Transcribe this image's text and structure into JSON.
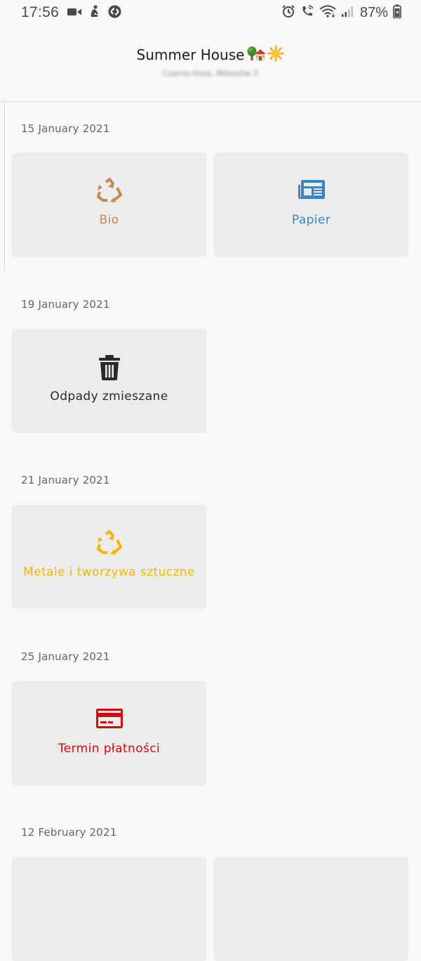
{
  "status_bar": {
    "time": "17:56",
    "battery": "87%",
    "icons": [
      "video-camera-icon",
      "person-sitting-icon",
      "shazam-icon",
      "alarm-icon",
      "wifi-calling-icon",
      "wifi-icon",
      "signal-icon",
      "battery-charging-icon"
    ]
  },
  "header": {
    "title": "Summer House",
    "emoji_icons": [
      "tree-house-emoji",
      "sun-emoji"
    ],
    "subtitle": "Czarna Hoża, Miłoszów 2"
  },
  "sections": [
    {
      "date": "15 January 2021",
      "tiles": [
        {
          "label": "Bio",
          "icon": "recycle-icon",
          "color": "#c38a4e"
        },
        {
          "label": "Papier",
          "icon": "newspaper-icon",
          "color": "#3a86c0"
        }
      ]
    },
    {
      "date": "19 January 2021",
      "tiles": [
        {
          "label": "Odpady zmieszane",
          "icon": "trash-icon",
          "color": "#2a2a2a"
        }
      ]
    },
    {
      "date": "21 January 2021",
      "tiles": [
        {
          "label": "Metale i tworzywa sztuczne",
          "icon": "recycle-icon",
          "color": "#f1b800"
        }
      ]
    },
    {
      "date": "25 January 2021",
      "tiles": [
        {
          "label": "Termin płatności",
          "icon": "credit-card-icon",
          "color": "#d10a0a"
        }
      ]
    },
    {
      "date": "12 February 2021",
      "tiles": []
    }
  ]
}
